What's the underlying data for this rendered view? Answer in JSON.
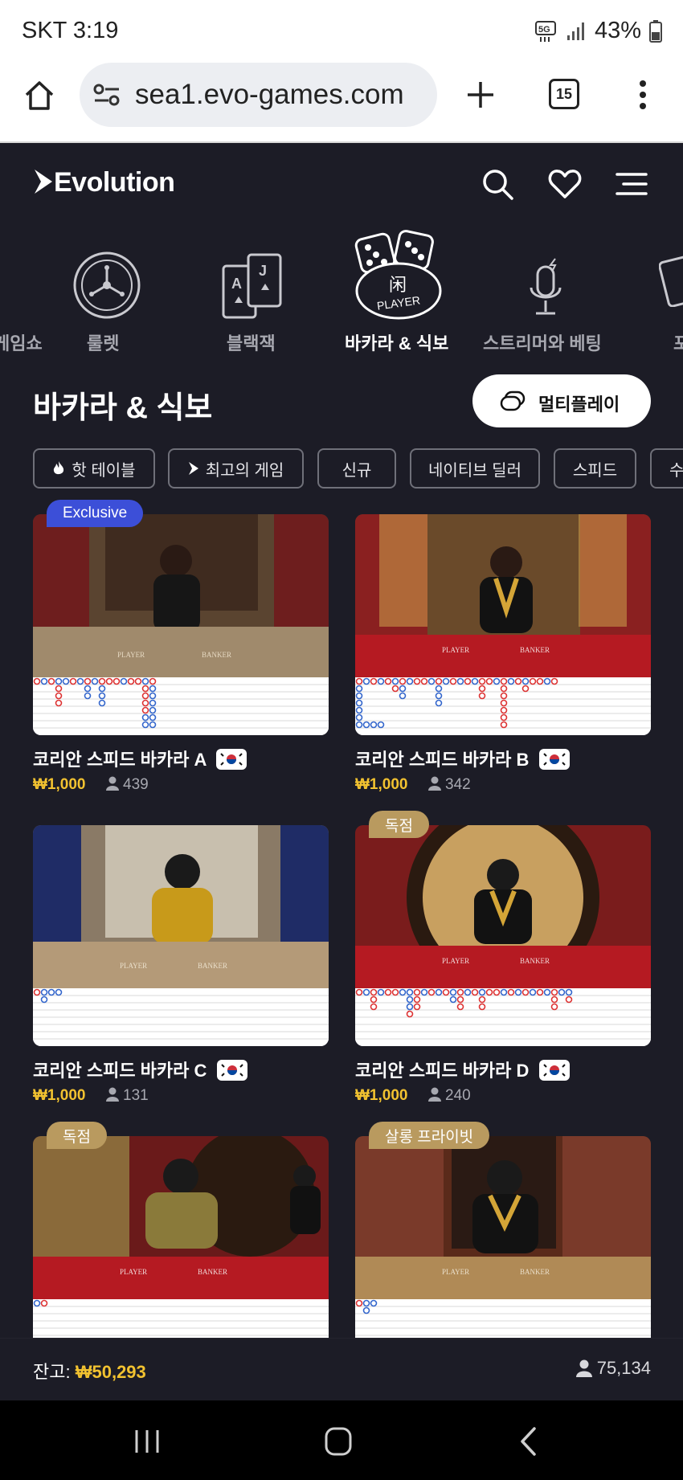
{
  "status_bar": {
    "time": "SKT 3:19",
    "network": "5G",
    "battery": "43%"
  },
  "browser": {
    "url": "sea1.evo-games.com",
    "tab_count": "15"
  },
  "header": {
    "logo": "Evolution"
  },
  "categories": [
    {
      "label": "룰렛",
      "active": false
    },
    {
      "label": "블랙잭",
      "active": false
    },
    {
      "label": "바카라 & 식보",
      "active": true
    },
    {
      "label": "스트리머와 베팅",
      "active": false
    }
  ],
  "page": {
    "title": "바카라 & 식보",
    "multiplay_label": "멀티플레이"
  },
  "filters": [
    {
      "label": "핫 테이블",
      "icon": "flame-icon"
    },
    {
      "label": "최고의 게임",
      "icon": "evolution-mark-icon"
    },
    {
      "label": "신규"
    },
    {
      "label": "네이티브 딜러"
    },
    {
      "label": "스피드"
    },
    {
      "label": "수"
    }
  ],
  "games": [
    {
      "name": "코리안 스피드 바카라 A",
      "price": "₩1,000",
      "players": "439",
      "badge": "Exclusive",
      "badge_color": "#3c4fd8",
      "flag": "korea-flag-icon"
    },
    {
      "name": "코리안 스피드 바카라 B",
      "price": "₩1,000",
      "players": "342",
      "badge": "",
      "flag": "korea-flag-icon"
    },
    {
      "name": "코리안 스피드 바카라 C",
      "price": "₩1,000",
      "players": "131",
      "badge": "",
      "flag": "korea-flag-icon"
    },
    {
      "name": "코리안 스피드 바카라 D",
      "price": "₩1,000",
      "players": "240",
      "badge": "독점",
      "badge_color": "#b99a5f",
      "flag": "korea-flag-icon"
    },
    {
      "name": "",
      "price": "",
      "players": "",
      "badge": "독점",
      "badge_color": "#b99a5f"
    },
    {
      "name": "",
      "price": "",
      "players": "",
      "badge": "살롱 프라이빗",
      "badge_color": "#b99a5f"
    }
  ],
  "footer": {
    "balance_label": "잔고: ",
    "balance_value": "₩50,293",
    "online_count": "75,134"
  },
  "colors": {
    "background": "#1c1c26",
    "accent_gold": "#f2c230",
    "exclusive_blue": "#3c4fd8",
    "badge_gold": "#b99a5f"
  }
}
